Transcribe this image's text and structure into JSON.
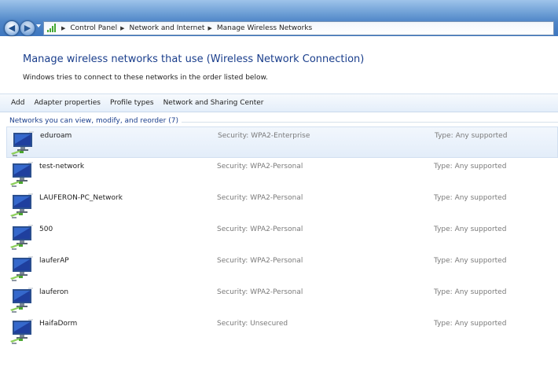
{
  "address_bar": {
    "breadcrumbs": [
      "Control Panel",
      "Network and Internet",
      "Manage Wireless Networks"
    ],
    "back_icon": "back-arrow-icon",
    "forward_icon": "forward-arrow-icon"
  },
  "header": {
    "title": "Manage wireless networks that use (Wireless Network Connection)",
    "description": "Windows tries to connect to these networks in the order listed below."
  },
  "toolbar": {
    "items": [
      "Add",
      "Adapter properties",
      "Profile types",
      "Network and Sharing Center"
    ]
  },
  "group": {
    "header": "Networks you can view, modify, and reorder (7)"
  },
  "networks": [
    {
      "name": "eduroam",
      "security": "Security: WPA2-Enterprise",
      "type": "Type: Any supported",
      "selected": true
    },
    {
      "name": "test-network",
      "security": "Security: WPA2-Personal",
      "type": "Type: Any supported",
      "selected": false
    },
    {
      "name": "LAUFERON-PC_Network",
      "security": "Security: WPA2-Personal",
      "type": "Type: Any supported",
      "selected": false
    },
    {
      "name": "500",
      "security": "Security: WPA2-Personal",
      "type": "Type: Any supported",
      "selected": false
    },
    {
      "name": "lauferAP",
      "security": "Security: WPA2-Personal",
      "type": "Type: Any supported",
      "selected": false
    },
    {
      "name": "lauferon",
      "security": "Security: WPA2-Personal",
      "type": "Type: Any supported",
      "selected": false
    },
    {
      "name": "HaifaDorm",
      "security": "Security: Unsecured",
      "type": "Type: Any supported",
      "selected": false
    }
  ],
  "colors": {
    "title_blue": "#1a3e8c",
    "selection_bg": "#e3edf9",
    "signal_green": "#44a832"
  }
}
